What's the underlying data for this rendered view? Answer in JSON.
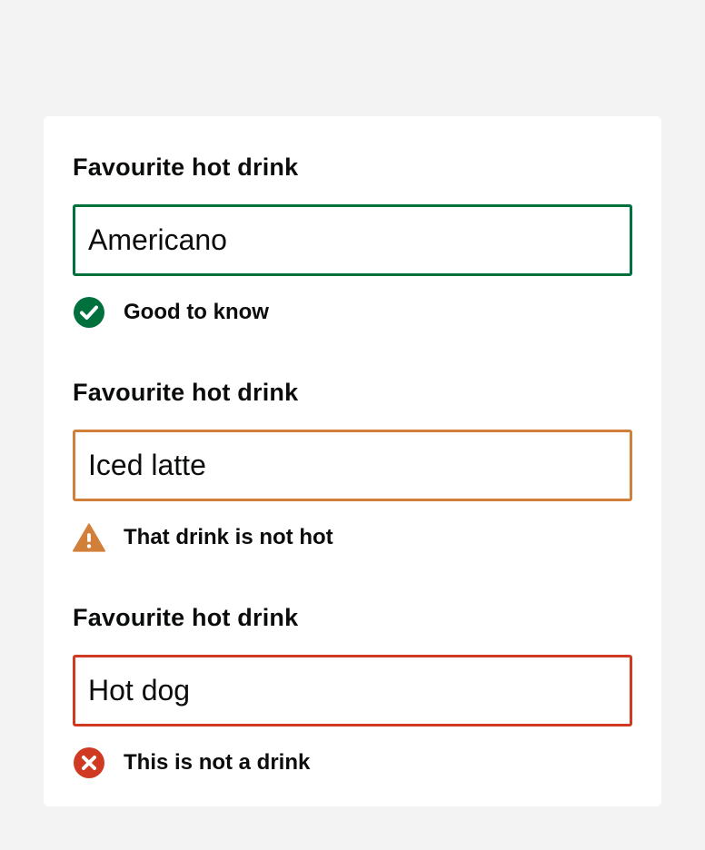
{
  "fields": [
    {
      "label": "Favourite hot drink",
      "value": "Americano",
      "status": "success",
      "message": "Good to know",
      "icon": "check-circle-icon",
      "color": "#00703c"
    },
    {
      "label": "Favourite hot drink",
      "value": "Iced latte",
      "status": "warning",
      "message": "That drink is not hot",
      "icon": "warning-triangle-icon",
      "color": "#d27f39"
    },
    {
      "label": "Favourite hot drink",
      "value": "Hot dog",
      "status": "error",
      "message": "This is not a drink",
      "icon": "error-circle-icon",
      "color": "#d03a22"
    }
  ]
}
